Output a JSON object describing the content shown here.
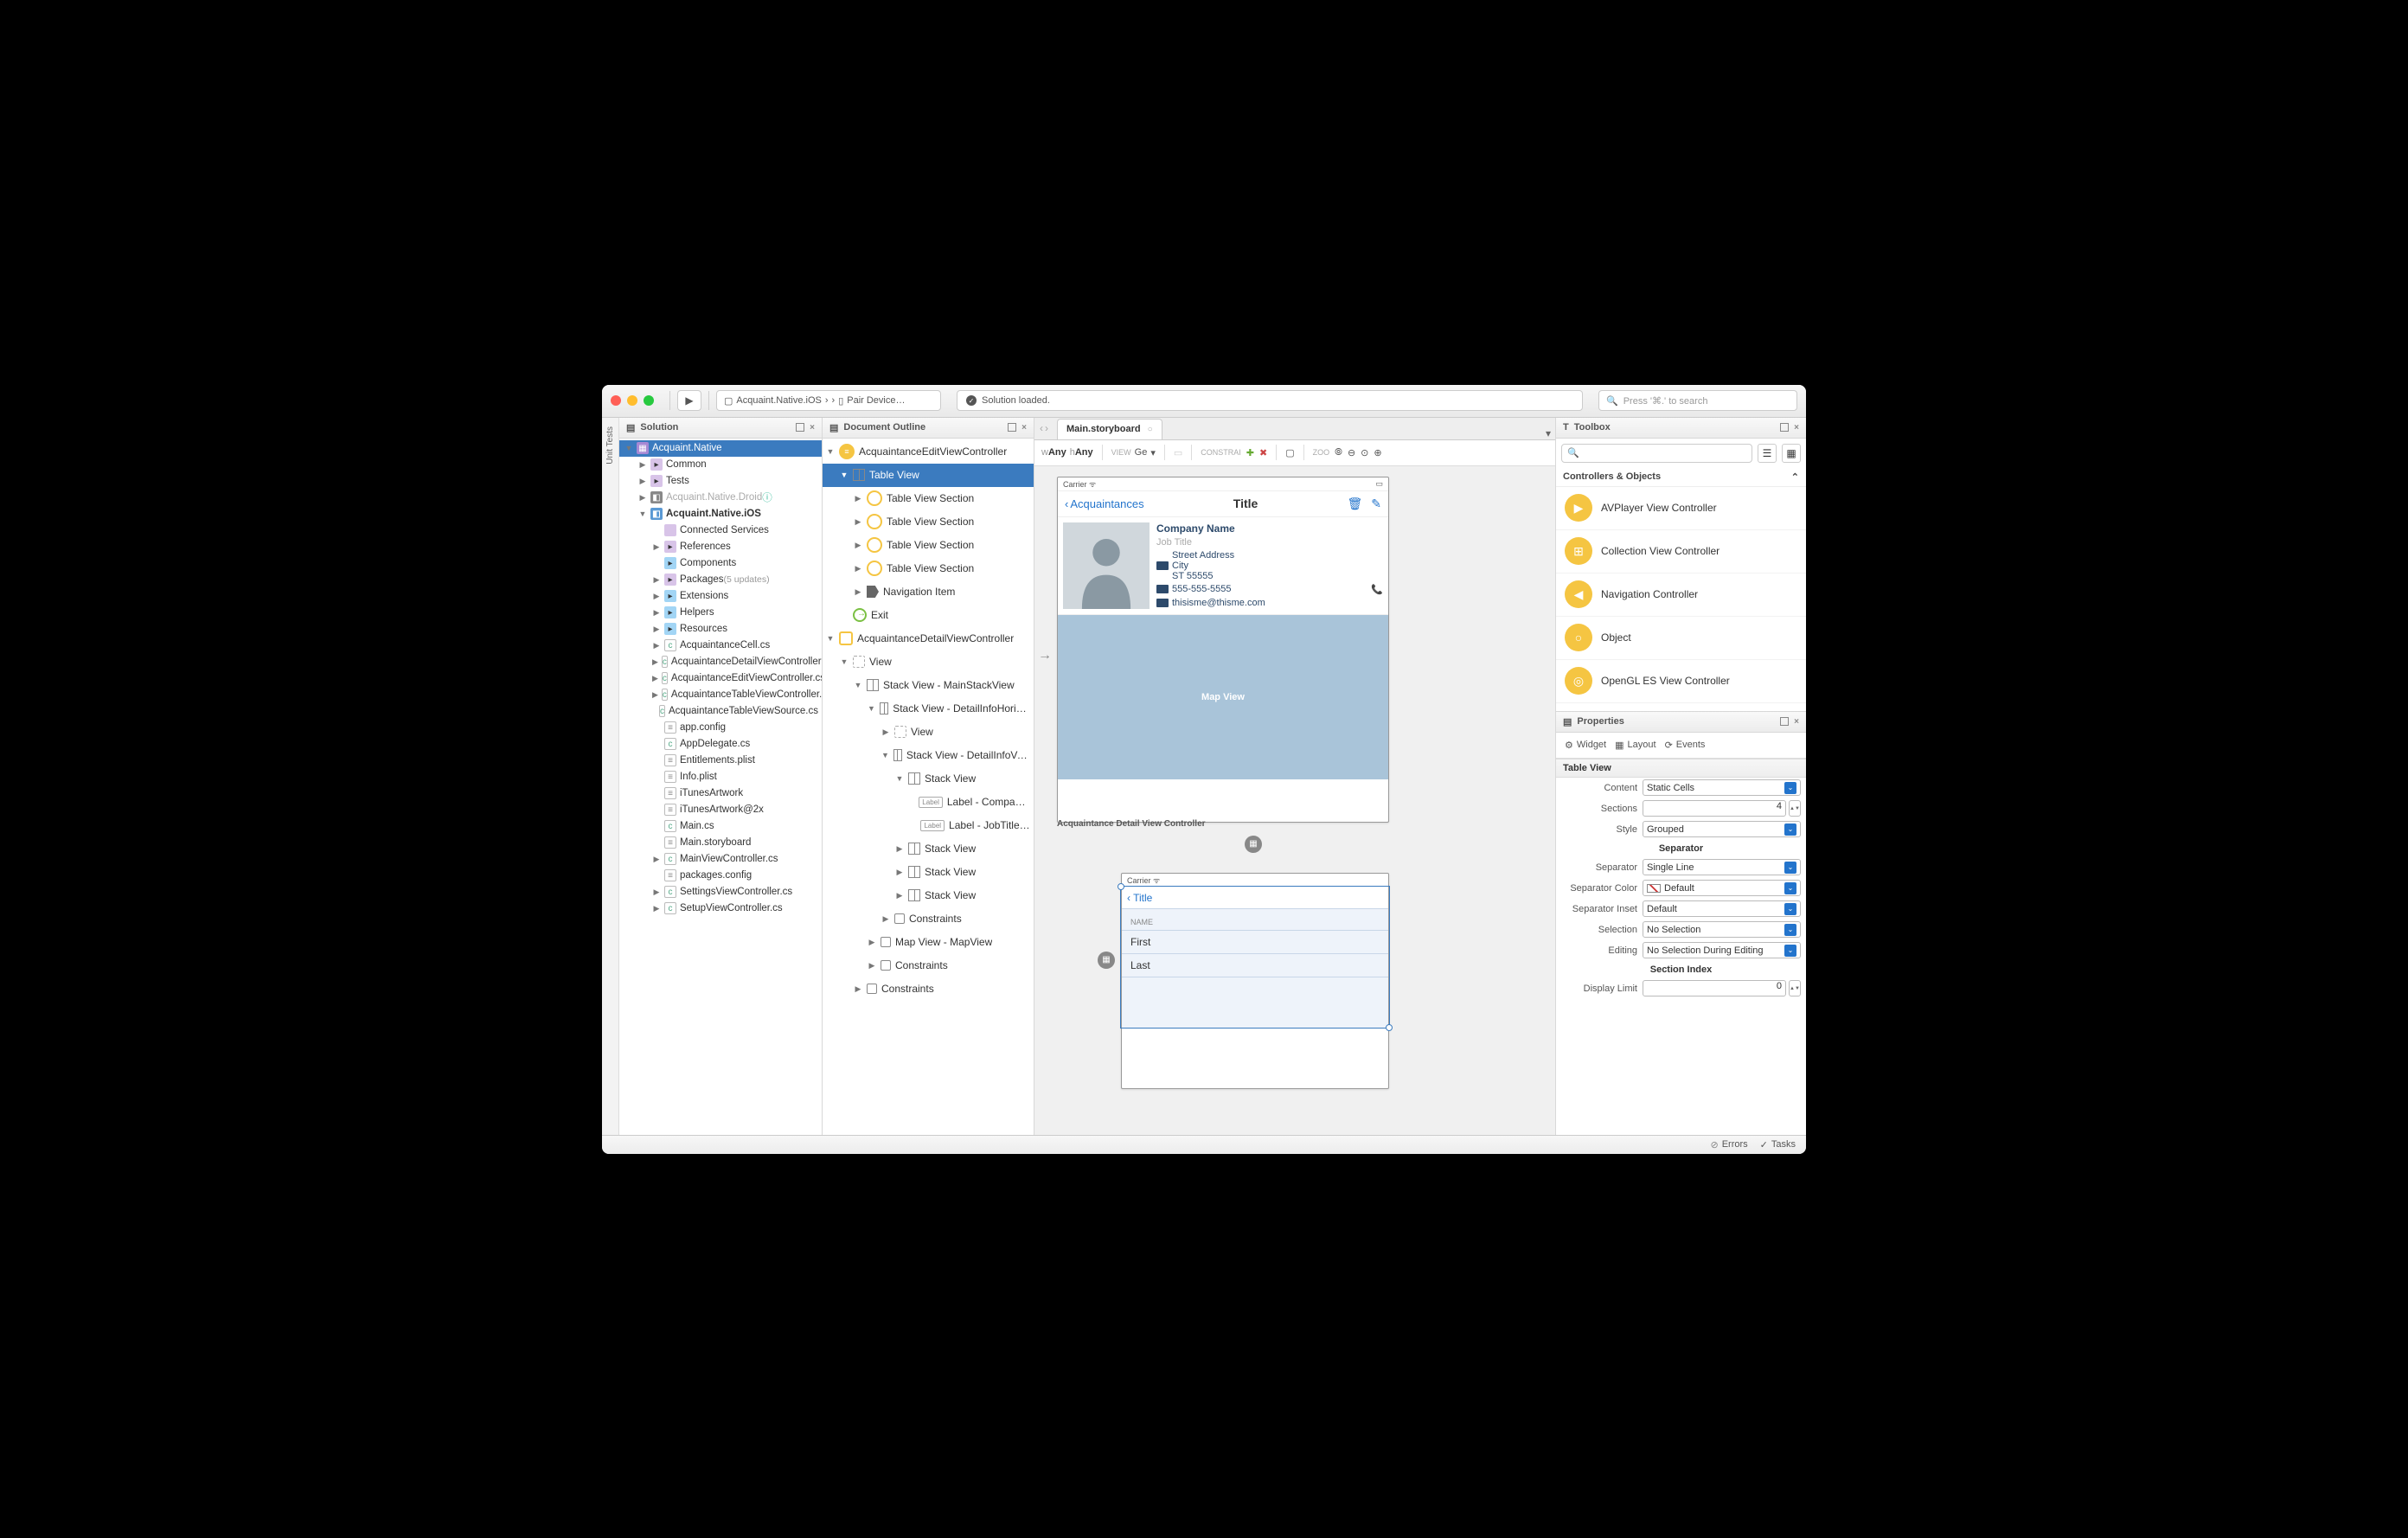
{
  "titlebar": {
    "breadcrumb": [
      "Acquaint.Native.iOS",
      "Pair Device…"
    ],
    "status": "Solution loaded.",
    "search_placeholder": "Press '⌘.' to search"
  },
  "side_tab": "Unit Tests",
  "solution": {
    "title": "Solution",
    "root": "Acquaint.Native",
    "items": [
      {
        "t": "Common",
        "k": "folder",
        "d": 1,
        "arr": true
      },
      {
        "t": "Tests",
        "k": "folder",
        "d": 1,
        "arr": true
      },
      {
        "t": "Acquaint.Native.Droid",
        "k": "proj-dim",
        "d": 1,
        "arr": true,
        "info": true
      },
      {
        "t": "Acquaint.Native.iOS",
        "k": "proj-bold",
        "d": 1,
        "arr": true,
        "open": true
      },
      {
        "t": "Connected Services",
        "k": "svc",
        "d": 2
      },
      {
        "t": "References",
        "k": "folder",
        "d": 2,
        "arr": true
      },
      {
        "t": "Components",
        "k": "folder-b",
        "d": 2
      },
      {
        "t": "Packages",
        "k": "folder",
        "d": 2,
        "arr": true,
        "suffix": "(5 updates)"
      },
      {
        "t": "Extensions",
        "k": "folder-b",
        "d": 2,
        "arr": true
      },
      {
        "t": "Helpers",
        "k": "folder-b",
        "d": 2,
        "arr": true
      },
      {
        "t": "Resources",
        "k": "folder-b",
        "d": 2,
        "arr": true
      },
      {
        "t": "AcquaintanceCell.cs",
        "k": "cs",
        "d": 2,
        "arr": true
      },
      {
        "t": "AcquaintanceDetailViewController.cs",
        "k": "cs",
        "d": 2,
        "arr": true
      },
      {
        "t": "AcquaintanceEditViewController.cs",
        "k": "cs",
        "d": 2,
        "arr": true
      },
      {
        "t": "AcquaintanceTableViewController.cs",
        "k": "cs",
        "d": 2,
        "arr": true
      },
      {
        "t": "AcquaintanceTableViewSource.cs",
        "k": "cs",
        "d": 2
      },
      {
        "t": "app.config",
        "k": "file",
        "d": 2
      },
      {
        "t": "AppDelegate.cs",
        "k": "cs",
        "d": 2
      },
      {
        "t": "Entitlements.plist",
        "k": "file",
        "d": 2
      },
      {
        "t": "Info.plist",
        "k": "file",
        "d": 2
      },
      {
        "t": "iTunesArtwork",
        "k": "file",
        "d": 2
      },
      {
        "t": "iTunesArtwork@2x",
        "k": "file",
        "d": 2
      },
      {
        "t": "Main.cs",
        "k": "cs",
        "d": 2
      },
      {
        "t": "Main.storyboard",
        "k": "file",
        "d": 2
      },
      {
        "t": "MainViewController.cs",
        "k": "cs",
        "d": 2,
        "arr": true
      },
      {
        "t": "packages.config",
        "k": "file",
        "d": 2
      },
      {
        "t": "SettingsViewController.cs",
        "k": "cs",
        "d": 2,
        "arr": true
      },
      {
        "t": "SetupViewController.cs",
        "k": "cs",
        "d": 2,
        "arr": true
      }
    ]
  },
  "outline": {
    "title": "Document Outline",
    "items": [
      {
        "t": "AcquaintanceEditViewController",
        "k": "circle-filled",
        "d": 0,
        "arr": true,
        "open": true
      },
      {
        "t": "Table View",
        "k": "grid",
        "d": 1,
        "arr": true,
        "open": true,
        "selected": true
      },
      {
        "t": "Table View Section",
        "k": "circle",
        "d": 2,
        "arr": true
      },
      {
        "t": "Table View Section",
        "k": "circle",
        "d": 2,
        "arr": true
      },
      {
        "t": "Table View Section",
        "k": "circle",
        "d": 2,
        "arr": true
      },
      {
        "t": "Table View Section",
        "k": "circle",
        "d": 2,
        "arr": true
      },
      {
        "t": "Navigation Item",
        "k": "tag",
        "d": 2,
        "arr": true
      },
      {
        "t": "Exit",
        "k": "exit",
        "d": 1
      },
      {
        "t": "AcquaintanceDetailViewController",
        "k": "square",
        "d": 0,
        "arr": true,
        "open": true
      },
      {
        "t": "View",
        "k": "dotted",
        "d": 1,
        "arr": true,
        "open": true
      },
      {
        "t": "Stack View - MainStackView",
        "k": "grid",
        "d": 2,
        "arr": true,
        "open": true
      },
      {
        "t": "Stack View - DetailInfoHorizontalStackView",
        "k": "grid",
        "d": 3,
        "arr": true,
        "open": true
      },
      {
        "t": "View",
        "k": "dotted",
        "d": 4,
        "arr": true
      },
      {
        "t": "Stack View - DetailInfoVerticalStackView",
        "k": "grid",
        "d": 4,
        "arr": true,
        "open": true
      },
      {
        "t": "Stack View",
        "k": "grid",
        "d": 5,
        "arr": true,
        "open": true
      },
      {
        "t": "Label - CompanyNameLabel",
        "k": "label",
        "d": 6
      },
      {
        "t": "Label - JobTitleLabel",
        "k": "label",
        "d": 6
      },
      {
        "t": "Stack View",
        "k": "grid",
        "d": 5,
        "arr": true
      },
      {
        "t": "Stack View",
        "k": "grid",
        "d": 5,
        "arr": true
      },
      {
        "t": "Stack View",
        "k": "grid",
        "d": 5,
        "arr": true
      },
      {
        "t": "Constraints",
        "k": "pin",
        "d": 4,
        "arr": true
      },
      {
        "t": "Map View - MapView",
        "k": "pin",
        "d": 3,
        "arr": true
      },
      {
        "t": "Constraints",
        "k": "pin",
        "d": 3,
        "arr": true
      },
      {
        "t": "Constraints",
        "k": "pin",
        "d": 2,
        "arr": true
      }
    ]
  },
  "canvas": {
    "tab": "Main.storyboard",
    "size_w": "wAny",
    "size_h": "hAny",
    "view_label": "VIEW",
    "view_value": "Ge",
    "constraints_label": "CONSTRAI",
    "zoom_label": "ZOO",
    "phone1": {
      "carrier": "Carrier",
      "back": "Acquaintances",
      "title": "Title",
      "company": "Company Name",
      "job": "Job Title",
      "street": "Street Address",
      "city": "City",
      "zip": "ST 55555",
      "phone": "555-555-5555",
      "email": "thisisme@thisme.com",
      "map": "Map View",
      "caption": "Acquaintance Detail View Controller"
    },
    "phone2": {
      "carrier": "Carrier",
      "back": "Title",
      "section": "NAME",
      "row1": "First",
      "row2": "Last"
    }
  },
  "toolbox": {
    "title": "Toolbox",
    "group": "Controllers & Objects",
    "items": [
      "AVPlayer View Controller",
      "Collection View Controller",
      "Navigation Controller",
      "Object",
      "OpenGL ES View Controller"
    ]
  },
  "properties": {
    "title": "Properties",
    "tabs": [
      "Widget",
      "Layout",
      "Events"
    ],
    "section": "Table View",
    "rows": {
      "content_label": "Content",
      "content_value": "Static Cells",
      "sections_label": "Sections",
      "sections_value": "4",
      "style_label": "Style",
      "style_value": "Grouped",
      "sep_head": "Separator",
      "separator_label": "Separator",
      "separator_value": "Single Line",
      "sepcolor_label": "Separator Color",
      "sepcolor_value": "Default",
      "sepinset_label": "Separator Inset",
      "sepinset_value": "Default",
      "selection_label": "Selection",
      "selection_value": "No Selection",
      "editing_label": "Editing",
      "editing_value": "No Selection During Editing",
      "index_head": "Section Index",
      "display_label": "Display Limit",
      "display_value": "0"
    }
  },
  "bottombar": {
    "errors": "Errors",
    "tasks": "Tasks"
  }
}
